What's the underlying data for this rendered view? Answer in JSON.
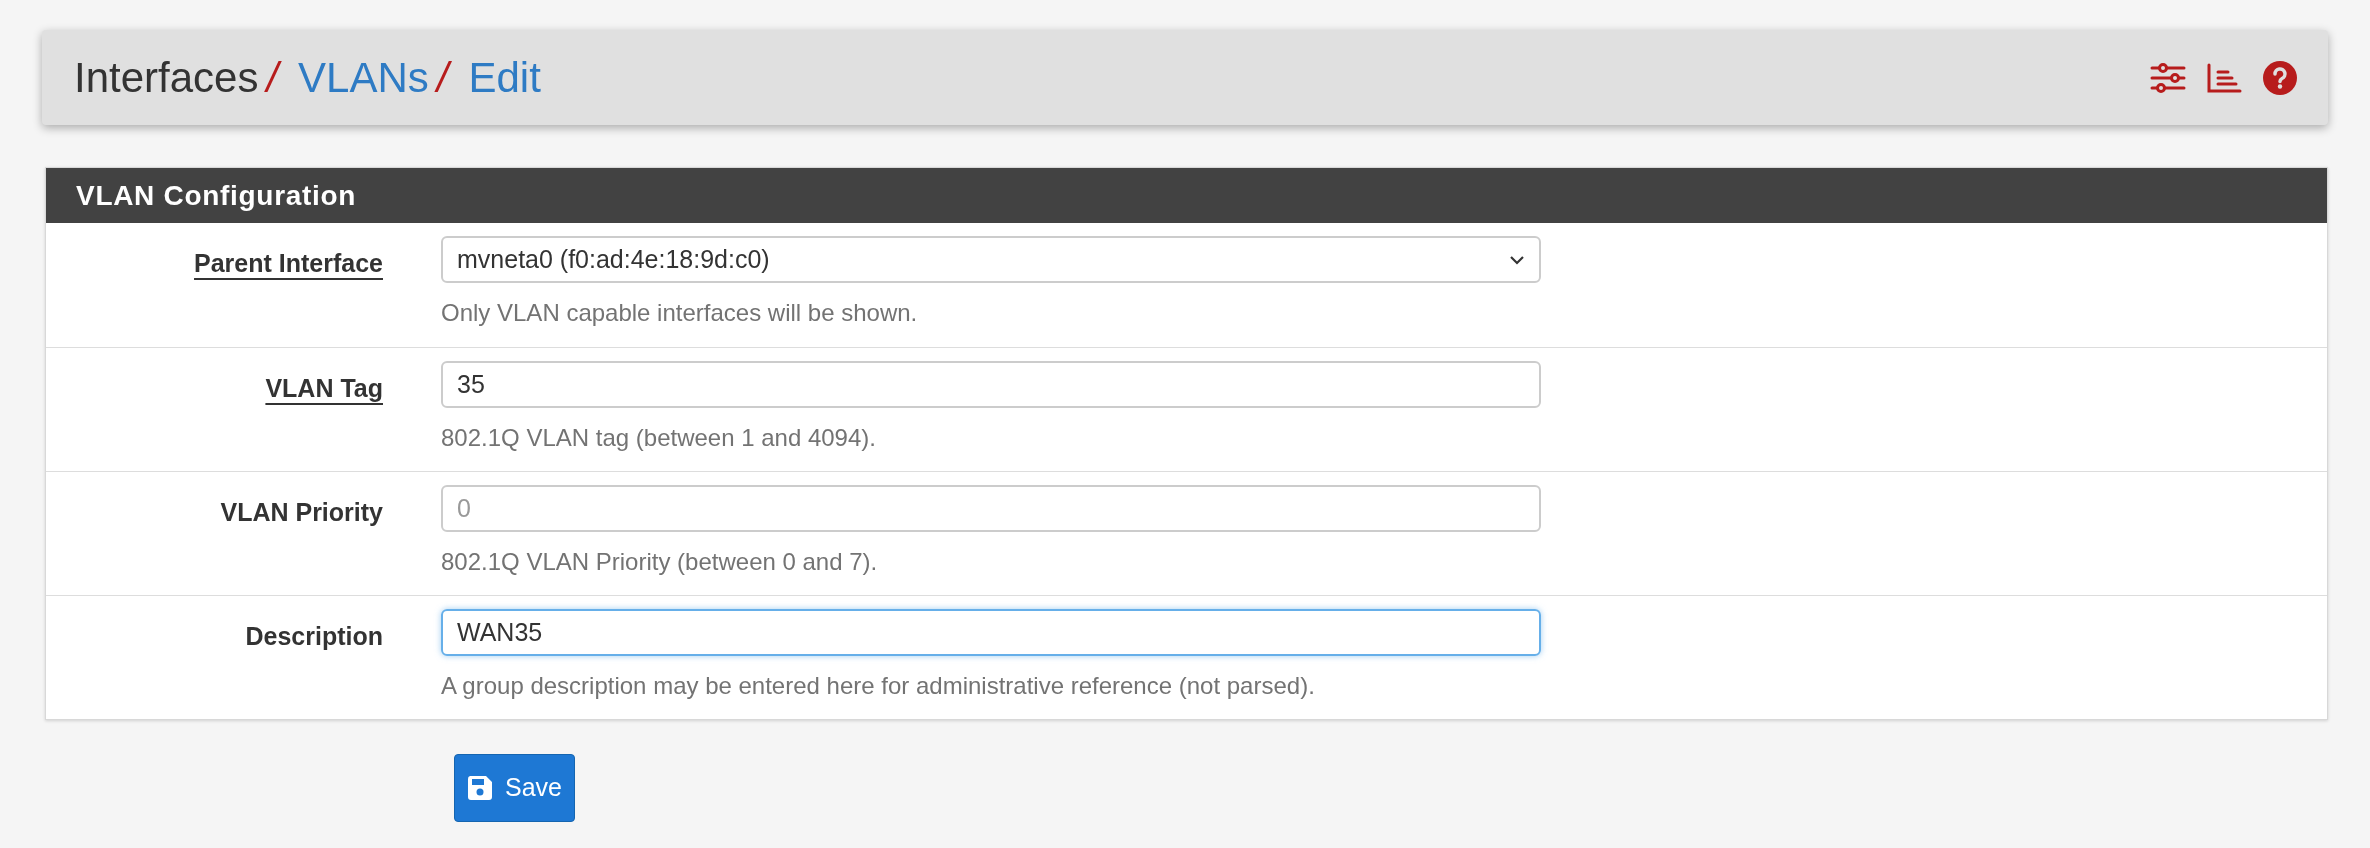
{
  "breadcrumb": [
    {
      "label": "Interfaces",
      "link": false
    },
    {
      "label": "VLANs",
      "link": true
    },
    {
      "label": "Edit",
      "link": true
    }
  ],
  "breadcrumb_separator": "/",
  "header_icons": [
    {
      "kind": "sliders"
    },
    {
      "kind": "log"
    },
    {
      "kind": "help"
    }
  ],
  "panel": {
    "title": "VLAN Configuration",
    "rows": [
      {
        "label": "Parent Interface",
        "required": true,
        "kind": "select",
        "value": "mvneta0 (f0:ad:4e:18:9d:c0)",
        "help": "Only VLAN capable interfaces will be shown.",
        "focused": false
      },
      {
        "label": "VLAN Tag",
        "required": true,
        "kind": "text",
        "value": "35",
        "help": "802.1Q VLAN tag (between 1 and 4094).",
        "focused": false
      },
      {
        "label": "VLAN Priority",
        "required": false,
        "kind": "text",
        "placeholder": "0",
        "help": "802.1Q VLAN Priority (between 0 and 7).",
        "focused": false
      },
      {
        "label": "Description",
        "required": false,
        "kind": "text",
        "value": "WAN35",
        "help": "A group description may be entered here for administrative reference (not parsed).",
        "focused": true
      }
    ]
  },
  "save_button": {
    "label": "Save"
  }
}
